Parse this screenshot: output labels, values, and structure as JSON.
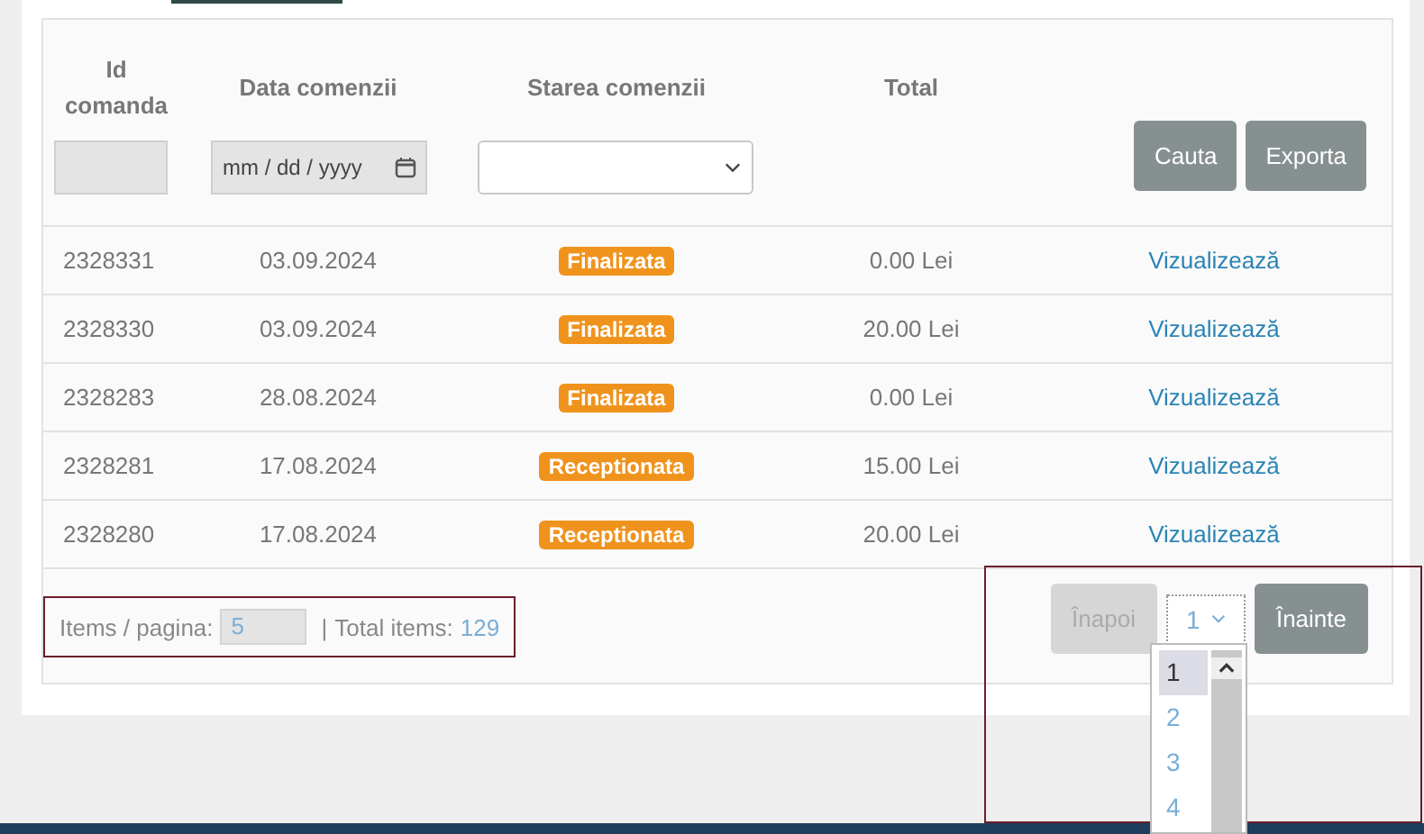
{
  "filters": {
    "columns": [
      {
        "label": "Id comanda",
        "kind": "text"
      },
      {
        "label": "Data comenzii",
        "kind": "date",
        "placeholder": "mm / dd / yyyy"
      },
      {
        "label": "Starea comenzii",
        "kind": "select"
      },
      {
        "label": "Total",
        "kind": "none"
      }
    ],
    "buttons": [
      "Cauta",
      "Exporta"
    ]
  },
  "rows": [
    {
      "id": "2328331",
      "date": "03.09.2024",
      "status": "Finalizata",
      "total": "0.00 Lei",
      "action": "Vizualizează"
    },
    {
      "id": "2328330",
      "date": "03.09.2024",
      "status": "Finalizata",
      "total": "20.00 Lei",
      "action": "Vizualizează"
    },
    {
      "id": "2328283",
      "date": "28.08.2024",
      "status": "Finalizata",
      "total": "0.00 Lei",
      "action": "Vizualizează"
    },
    {
      "id": "2328281",
      "date": "17.08.2024",
      "status": "Receptionata",
      "total": "15.00 Lei",
      "action": "Vizualizează"
    },
    {
      "id": "2328280",
      "date": "17.08.2024",
      "status": "Receptionata",
      "total": "20.00 Lei",
      "action": "Vizualizează"
    }
  ],
  "footer": {
    "items_label": "Items / pagina:",
    "items_per_page": "5",
    "separator": "|",
    "total_label": "Total items:",
    "total": "129"
  },
  "pagination": {
    "prev": {
      "label": "Înapoi",
      "disabled": true
    },
    "page": "1",
    "next": {
      "label": "Înainte",
      "disabled": false
    },
    "options": [
      {
        "label": "1",
        "selected": true
      },
      {
        "label": "2",
        "selected": false
      },
      {
        "label": "3",
        "selected": false
      },
      {
        "label": "4",
        "selected": false
      }
    ]
  }
}
